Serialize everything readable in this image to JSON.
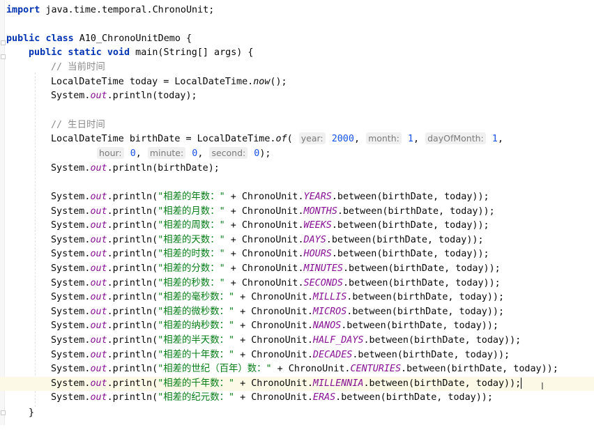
{
  "editor": {
    "line1": {
      "import_kw": "import",
      "import_path": " java.time.temporal.ChronoUnit;"
    },
    "class_decl": {
      "public_kw": "public",
      "class_kw": "class",
      "name": " A10_ChronoUnitDemo {"
    },
    "main_decl": {
      "kws": "public static void",
      "sig": " main(String[] args) {"
    },
    "comment_now": "// 当前时间",
    "now_line": {
      "a": "LocalDateTime today = LocalDateTime.",
      "m": "now",
      "b": "();"
    },
    "print_today": {
      "a": "System.",
      "out": "out",
      "b": ".println(today);"
    },
    "comment_birth": "// 生日时间",
    "birth_line": {
      "a": "LocalDateTime birthDate = LocalDateTime.",
      "m": "of",
      "b": "(",
      "hint_year": "year:",
      "year": "2000",
      "hint_month": "month:",
      "month": "1",
      "hint_day": "dayOfMonth:",
      "day": "1",
      "comma": ","
    },
    "birth_line2": {
      "hint_hour": "hour:",
      "hour": "0",
      "hint_minute": "minute:",
      "minute": "0",
      "hint_second": "second:",
      "second": "0",
      "end": ");"
    },
    "print_birth": {
      "a": "System.",
      "out": "out",
      "b": ".println(birthDate);"
    },
    "prints": [
      {
        "label": "\"相差的年数：\"",
        "unit": "YEARS"
      },
      {
        "label": "\"相差的月数：\"",
        "unit": "MONTHS"
      },
      {
        "label": "\"相差的周数：\"",
        "unit": "WEEKS"
      },
      {
        "label": "\"相差的天数：\"",
        "unit": "DAYS"
      },
      {
        "label": "\"相差的时数：\"",
        "unit": "HOURS"
      },
      {
        "label": "\"相差的分数：\"",
        "unit": "MINUTES"
      },
      {
        "label": "\"相差的秒数：\"",
        "unit": "SECONDS"
      },
      {
        "label": "\"相差的毫秒数：\"",
        "unit": "MILLIS"
      },
      {
        "label": "\"相差的微秒数：\"",
        "unit": "MICROS"
      },
      {
        "label": "\"相差的纳秒数：\"",
        "unit": "NANOS"
      },
      {
        "label": "\"相差的半天数：\"",
        "unit": "HALF_DAYS"
      },
      {
        "label": "\"相差的十年数：\"",
        "unit": "DECADES"
      },
      {
        "label": "\"相差的世纪（百年）数：\"",
        "unit": "CENTURIES"
      },
      {
        "label": "\"相差的千年数：\"",
        "unit": "MILLENNIA"
      },
      {
        "label": "\"相差的纪元数：\"",
        "unit": "ERAS"
      }
    ],
    "print_prefix": "System.",
    "print_out": "out",
    "print_mid": ".println(",
    "print_plus": " + ChronoUnit.",
    "print_suffix": ".between(birthDate, today));",
    "close_main": "}"
  }
}
